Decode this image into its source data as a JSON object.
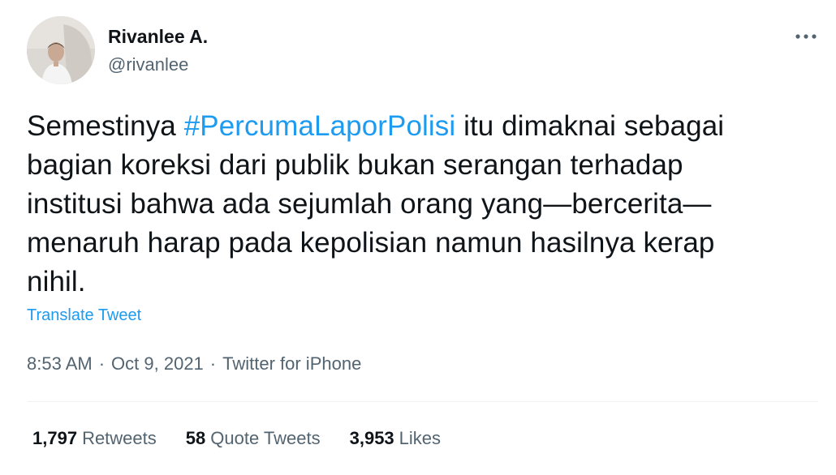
{
  "user": {
    "name": "Rivanlee A.",
    "handle": "@rivanlee"
  },
  "more_icon": "more-horizontal-icon",
  "tweet": {
    "lines": [
      {
        "pre": "Semestinya ",
        "hashtag": "#PercumaLaporPolisi",
        "post": " itu dimaknai sebagai"
      },
      {
        "text": "bagian koreksi dari publik bukan serangan terhadap"
      },
      {
        "text": "institusi bahwa ada sejumlah orang yang—bercerita—"
      },
      {
        "text": "menaruh harap pada kepolisian namun hasilnya kerap"
      },
      {
        "text": "nihil."
      }
    ]
  },
  "translate_label": "Translate Tweet",
  "meta": {
    "time": "8:53 AM",
    "separator": "·",
    "date": "Oct 9, 2021",
    "source": "Twitter for iPhone"
  },
  "stats": {
    "retweets": {
      "count": "1,797",
      "label": "Retweets"
    },
    "quotes": {
      "count": "58",
      "label": "Quote Tweets"
    },
    "likes": {
      "count": "3,953",
      "label": "Likes"
    }
  },
  "colors": {
    "link": "#1d9bf0",
    "text": "#0f1419",
    "secondary": "#536471",
    "divider": "#eff3f4"
  }
}
